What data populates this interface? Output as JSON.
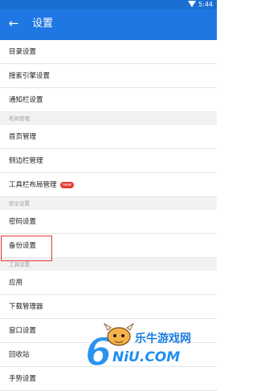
{
  "status_bar": {
    "time": "5:44",
    "wifi_icon": "wifi-icon"
  },
  "app_bar": {
    "back_icon": "←",
    "title": "设置"
  },
  "items_group1": [
    "目录设置",
    "搜索引擎设置",
    "通知栏设置"
  ],
  "section_layout": "布局管理",
  "items_group2": [
    "首页管理",
    "侧边栏管理",
    "工具栏布局管理"
  ],
  "badge_new": "new",
  "section_security": "安全设置",
  "items_group3": [
    "密码设置",
    "备份设置"
  ],
  "section_tools": "工具设置",
  "items_group4": [
    "应用",
    "下载管理器",
    "窗口设置",
    "回收站",
    "手势设置"
  ],
  "watermark": {
    "text_cn": "乐牛游戏网",
    "text_en": "NiU.COM",
    "logo_digit": "6"
  },
  "colors": {
    "appbar": "#1e77e2",
    "statusbar": "#1b6fd1",
    "highlight": "#e53935",
    "badge": "#e53935"
  }
}
